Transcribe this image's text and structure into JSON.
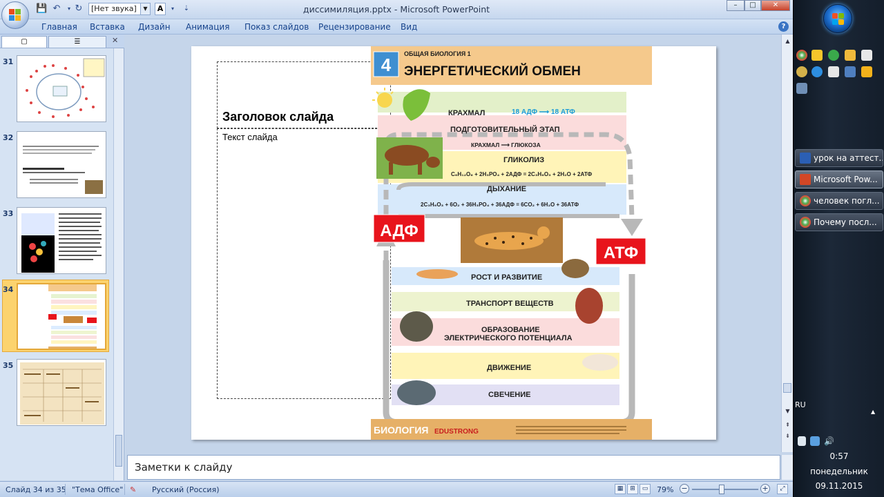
{
  "window": {
    "title": "диссимиляция.pptx - Microsoft PowerPoint",
    "sound_select": "[Нет звука]",
    "font_btn": "A",
    "min": "–",
    "max": "□",
    "close": "✕"
  },
  "ribbon": {
    "tabs": [
      "Главная",
      "Вставка",
      "Дизайн",
      "Анимация",
      "Показ слайдов",
      "Рецензирование",
      "Вид"
    ],
    "help": "?"
  },
  "thumbnails": [
    {
      "num": "31",
      "selected": false
    },
    {
      "num": "32",
      "selected": false
    },
    {
      "num": "33",
      "selected": false
    },
    {
      "num": "34",
      "selected": true
    },
    {
      "num": "35",
      "selected": false
    }
  ],
  "slide": {
    "title_placeholder": "Заголовок слайда",
    "text_placeholder": "Текст слайда",
    "poster": {
      "badge": "4",
      "series": "ОБЩАЯ БИОЛОГИЯ 1",
      "heading": "ЭНЕРГЕТИЧЕСКИЙ ОБМЕН",
      "starch": "КРАХМАЛ",
      "ratio": "18 АДФ ⟶ 18 АТФ",
      "prep": "ПОДГОТОВИТЕЛЬНЫЙ ЭТАП",
      "starch_glucose": "КРАХМАЛ ⟶ ГЛЮКОЗА",
      "glycolysis": "ГЛИКОЛИЗ",
      "glycolysis_eq": "C₆H₁₂O₆ + 2H₃PO₄ + 2АДФ = 2C₃H₆O₃ + 2H₂O + 2АТФ",
      "respiration": "ДЫХАНИЕ",
      "respiration_eq": "2C₃H₆O₃ + 6O₂ + 36H₃PO₄ + 36АДФ = 6CO₂ + 6H₂O + 36АТФ",
      "adf": "АДФ",
      "atf": "АТФ",
      "growth": "РОСТ И РАЗВИТИЕ",
      "transport": "ТРАНСПОРТ ВЕЩЕСТВ",
      "electric1": "ОБРАЗОВАНИЕ",
      "electric2": "ЭЛЕКТРИЧЕСКОГО ПОТЕНЦИАЛА",
      "movement": "ДВИЖЕНИЕ",
      "glow": "СВЕЧЕНИЕ",
      "footer_left": "БИОЛОГИЯ",
      "footer_brand": "EDUSTRONG"
    }
  },
  "notes": {
    "text": "Заметки к слайду"
  },
  "status": {
    "slide_count": "Слайд 34 из 35",
    "theme": "\"Тема Office\"",
    "language": "Русский (Россия)",
    "zoom": "79%",
    "zoom_fraction": 0.45
  },
  "taskbar": {
    "tasks": [
      {
        "label": "урок на аттест...",
        "active": false,
        "icon_color": "#2b5fb4"
      },
      {
        "label": "Microsoft Pow...",
        "active": true,
        "icon_color": "#d24726"
      },
      {
        "label": "человек погл...",
        "active": false,
        "icon_color": "#4caf50"
      },
      {
        "label": "Почему посл...",
        "active": false,
        "icon_color": "#4caf50"
      }
    ],
    "lang": "RU",
    "time": "0:57",
    "day": "понедельник",
    "date": "09.11.2015"
  },
  "colors": {
    "accent": "#15428b",
    "selected_thumb": "#fcd36e",
    "adf_red": "#e8141c",
    "poster_header": "#f5c98c"
  }
}
